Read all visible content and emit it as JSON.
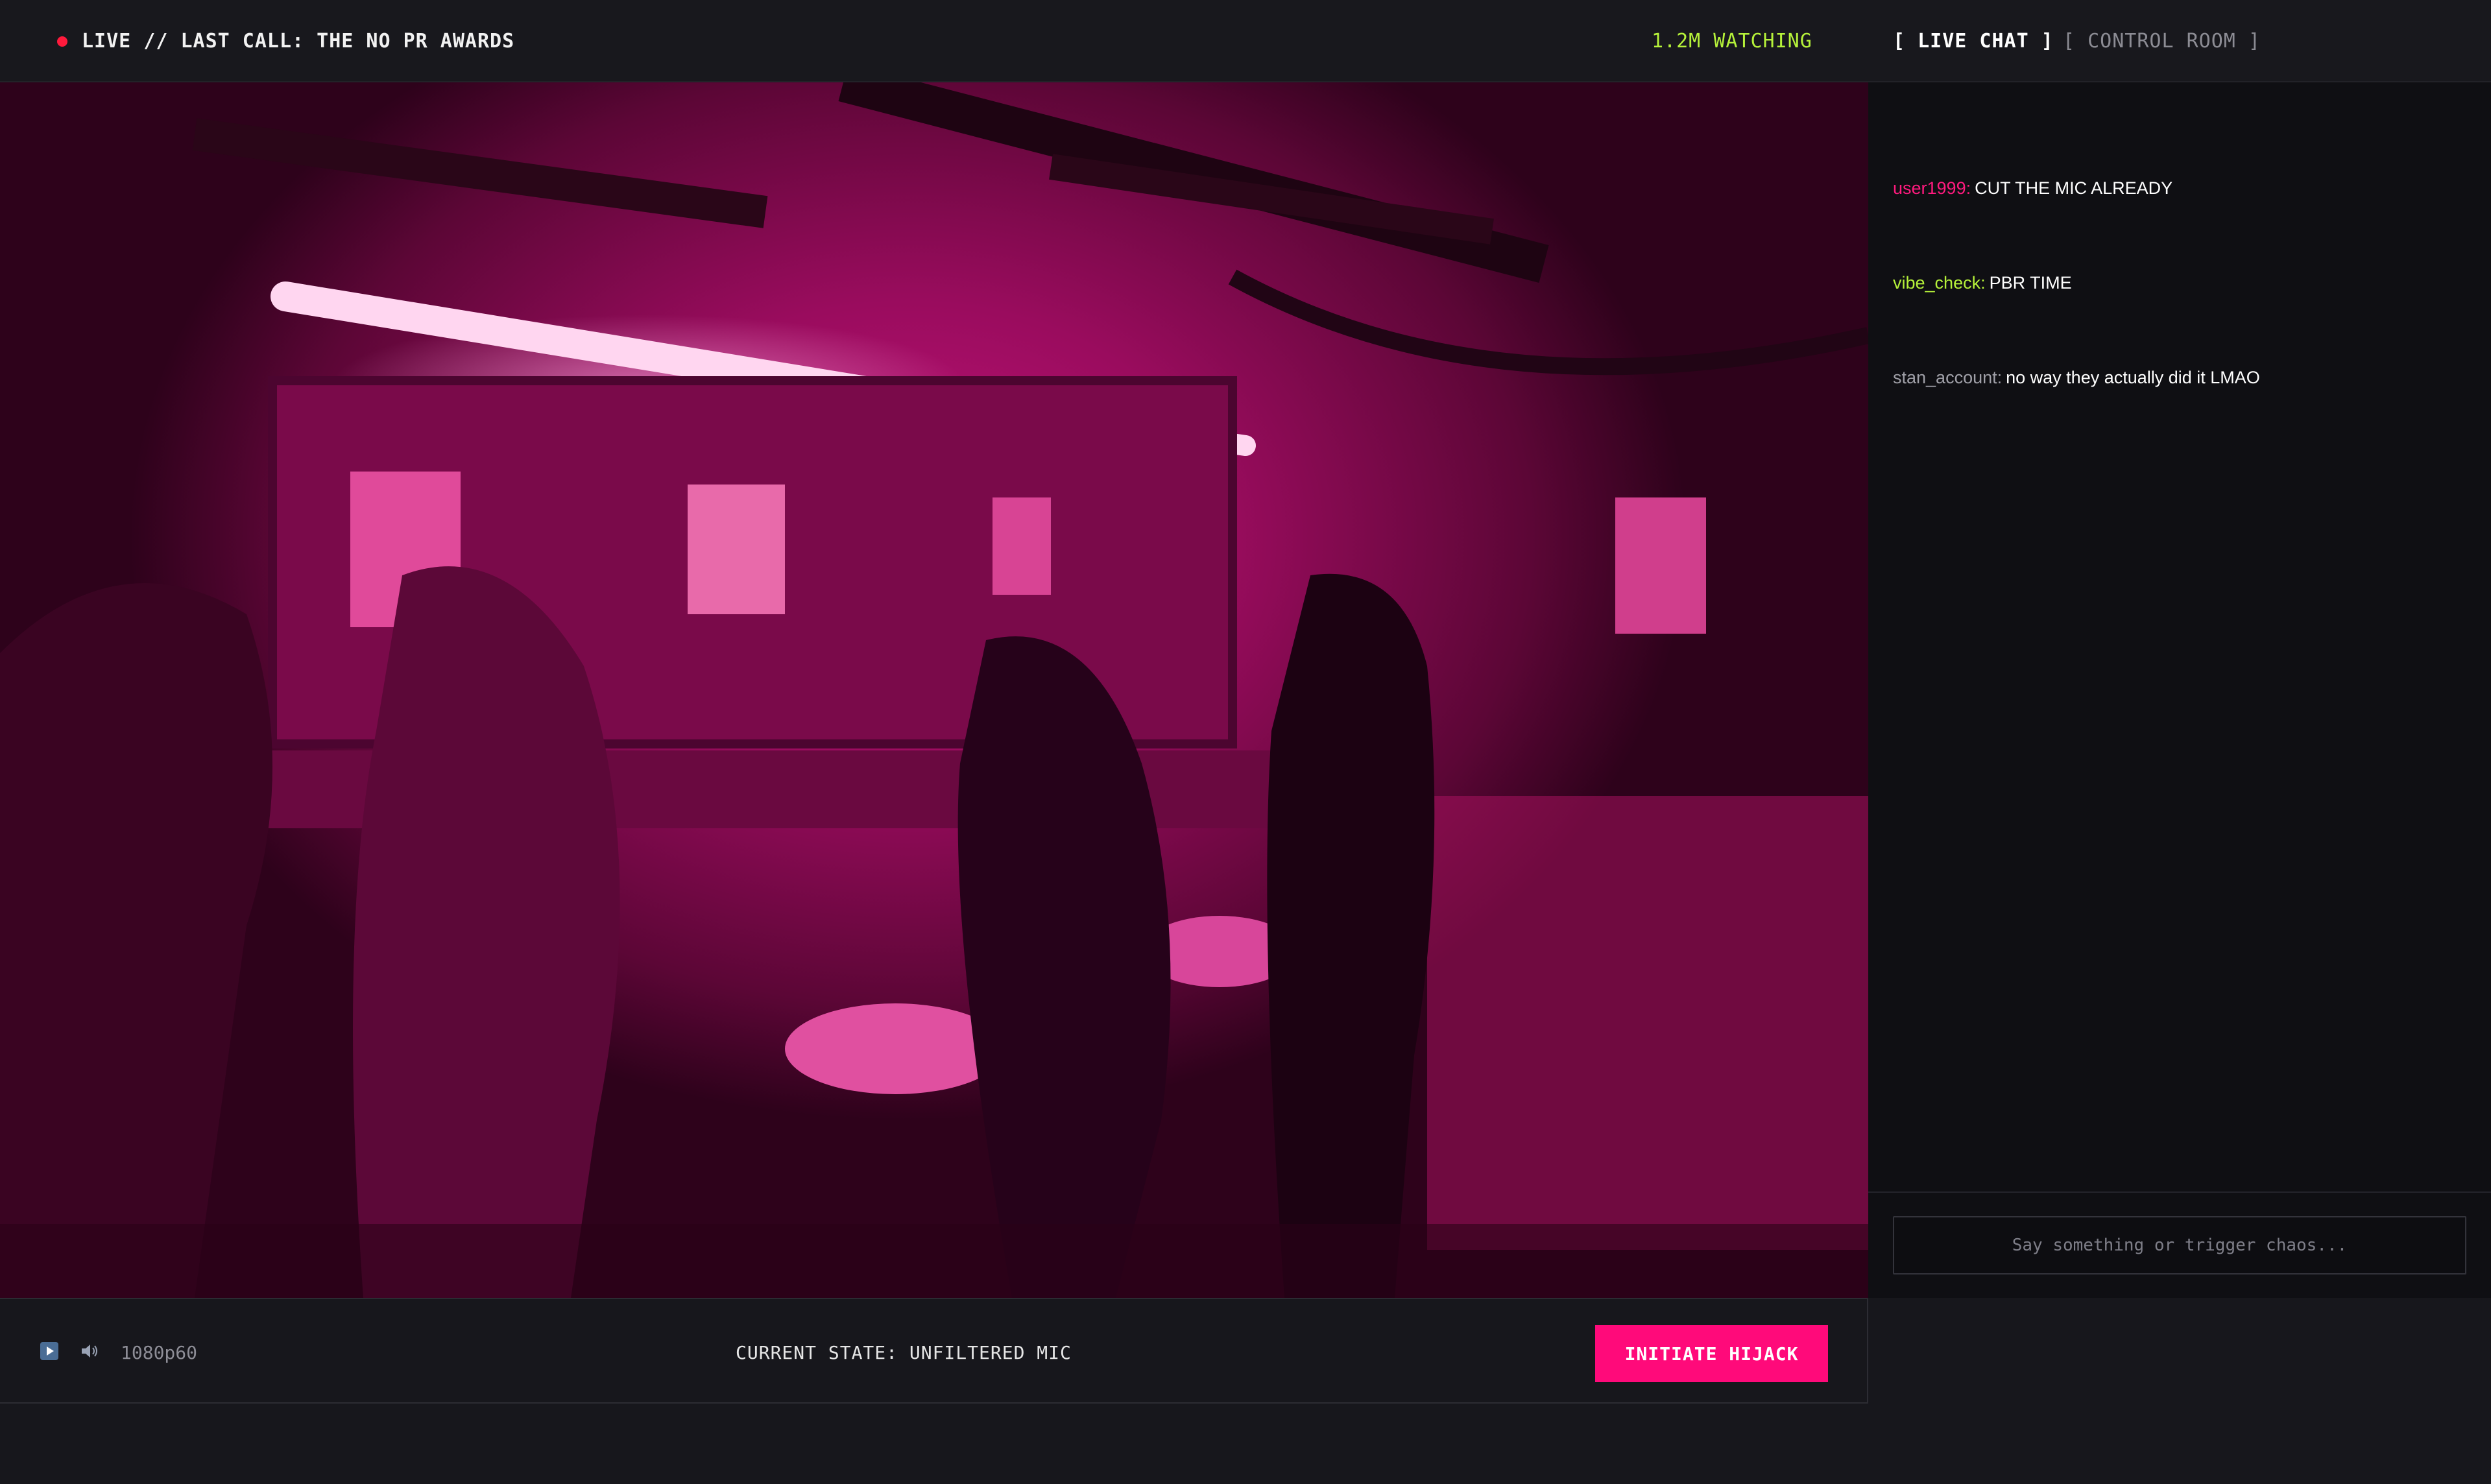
{
  "header": {
    "stream_title": "LIVE // LAST CALL: THE NO PR AWARDS",
    "viewer_count": "1.2M WATCHING",
    "tabs": [
      {
        "label": "[ LIVE CHAT ]",
        "active": true
      },
      {
        "label": "[ CONTROL ROOM ]",
        "active": false
      }
    ]
  },
  "chat": {
    "messages": [
      {
        "user": "user1999:",
        "text": "CUT THE MIC ALREADY"
      },
      {
        "user": "vibe_check:",
        "text": "PBR TIME"
      },
      {
        "user": "stan_account:",
        "text": "no way they actually did it LMAO"
      }
    ],
    "input_placeholder": "Say something or trigger chaos..."
  },
  "controls": {
    "play_icon": "play-icon",
    "volume_icon": "volume-icon",
    "quality": "1080p60",
    "current_state": "CURRENT STATE: UNFILTERED MIC",
    "hijack_label": "INITIATE HIJACK"
  },
  "colors": {
    "accent_pink": "#ff0a7a",
    "accent_lime": "#b6f23a",
    "live_red": "#ff1a3c",
    "background": "#17171c"
  }
}
